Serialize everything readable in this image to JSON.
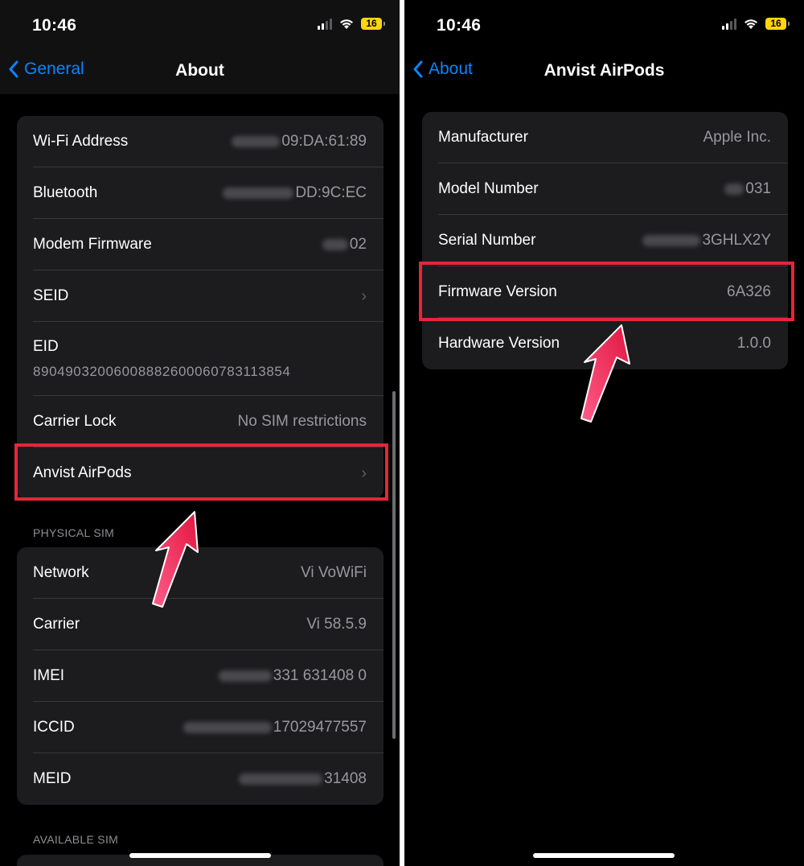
{
  "status": {
    "time": "10:46",
    "battery": "16"
  },
  "left": {
    "back_label": "General",
    "title": "About",
    "rows": [
      {
        "label": "Wi-Fi Address",
        "value": "09:DA:61:89"
      },
      {
        "label": "Bluetooth",
        "value": "DD:9C:EC"
      },
      {
        "label": "Modem Firmware",
        "value": "02"
      },
      {
        "label": "SEID"
      },
      {
        "label": "EID",
        "value": "89049032006008882600060783113854"
      },
      {
        "label": "Carrier Lock",
        "value": "No SIM restrictions"
      },
      {
        "label": "Anvist AirPods"
      }
    ],
    "physical_sim_header": "PHYSICAL SIM",
    "sim_rows": [
      {
        "label": "Network",
        "value": "Vi VoWiFi"
      },
      {
        "label": "Carrier",
        "value": "Vi 58.5.9"
      },
      {
        "label": "IMEI",
        "value": "331 631408 0"
      },
      {
        "label": "ICCID",
        "value": "17029477557"
      },
      {
        "label": "MEID",
        "value": "31408"
      }
    ],
    "available_sim_header": "AVAILABLE SIM"
  },
  "right": {
    "back_label": "About",
    "title": "Anvist AirPods",
    "rows": [
      {
        "label": "Manufacturer",
        "value": "Apple Inc."
      },
      {
        "label": "Model Number",
        "value": "031"
      },
      {
        "label": "Serial Number",
        "value": "3GHLX2Y"
      },
      {
        "label": "Firmware Version",
        "value": "6A326"
      },
      {
        "label": "Hardware Version",
        "value": "1.0.0"
      }
    ]
  },
  "icons": {
    "back": "chevron-left-icon",
    "disclosure": "chevron-right-icon",
    "signal": "cellular-signal-icon",
    "wifi": "wifi-icon",
    "battery": "battery-icon",
    "annotation": "red-arrow-icon"
  },
  "colors": {
    "accent": "#0a84ff",
    "highlight": "#e5263a",
    "arrow": "#ff2d6a",
    "battery": "#ffd60a"
  }
}
